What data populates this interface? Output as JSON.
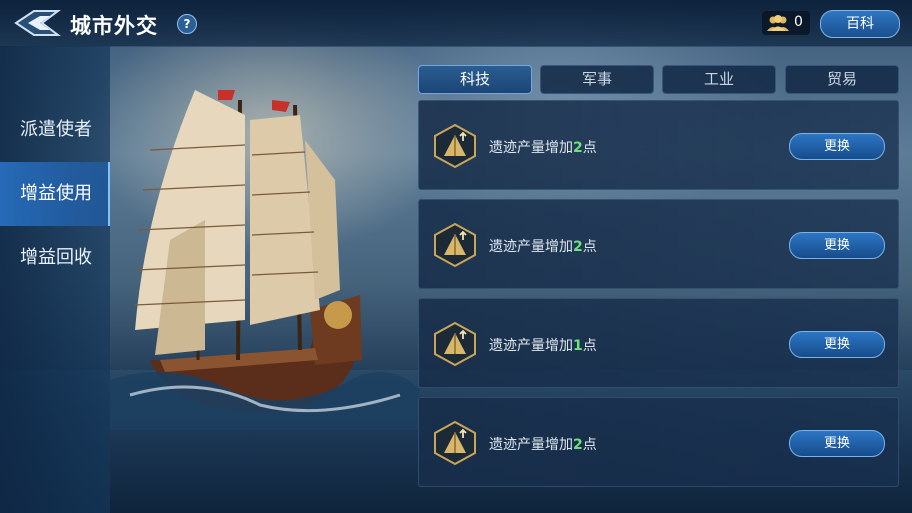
{
  "header": {
    "title": "城市外交",
    "help_label": "?",
    "resource_value": "0",
    "wiki_label": "百科"
  },
  "nav": {
    "items": [
      {
        "label": "派遣使者",
        "active": false
      },
      {
        "label": "增益使用",
        "active": true
      },
      {
        "label": "增益回收",
        "active": false
      }
    ]
  },
  "tabs": [
    {
      "label": "科技",
      "active": true
    },
    {
      "label": "军事",
      "active": false
    },
    {
      "label": "工业",
      "active": false
    },
    {
      "label": "贸易",
      "active": false
    }
  ],
  "cards": [
    {
      "prefix": "遗迹产量增加",
      "value": "2",
      "suffix": "点",
      "button": "更换"
    },
    {
      "prefix": "遗迹产量增加",
      "value": "2",
      "suffix": "点",
      "button": "更换"
    },
    {
      "prefix": "遗迹产量增加",
      "value": "1",
      "suffix": "点",
      "button": "更换"
    },
    {
      "prefix": "遗迹产量增加",
      "value": "2",
      "suffix": "点",
      "button": "更换"
    }
  ],
  "colors": {
    "accent_blue": "#2c76c4",
    "highlight_green": "#6fe07a",
    "icon_gold": "#d8b66a"
  },
  "icons": {
    "back": "back-arrow-icon",
    "help": "help-icon",
    "resource": "envoy-people-icon",
    "card": "pyramid-relic-icon"
  }
}
